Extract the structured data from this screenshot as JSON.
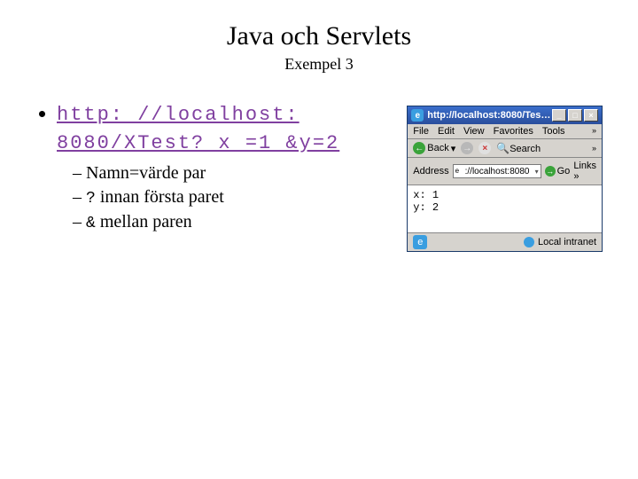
{
  "title": "Java och Servlets",
  "subtitle": "Exempel 3",
  "main_url_display": "http: //localhost: 8080/XTest? x =1 &y=2",
  "sub_bullets": [
    {
      "prefix_mono": "",
      "text": "Namn=värde par"
    },
    {
      "prefix_mono": "?",
      "text": " innan första paret"
    },
    {
      "prefix_mono": "&",
      "text": " mellan paren"
    }
  ],
  "browser": {
    "title": "http://localhost:8080/Tes…",
    "window_controls": {
      "minimize": "_",
      "maximize": "□",
      "close": "×"
    },
    "menu": [
      "File",
      "Edit",
      "View",
      "Favorites",
      "Tools"
    ],
    "menu_overflow": "»",
    "toolbar": {
      "back_label": "Back",
      "back_dropdown": "▾",
      "search_label": "Search",
      "overflow": "»"
    },
    "address": {
      "label": "Address",
      "value": "://localhost:8080",
      "go_label": "Go",
      "links_label": "Links",
      "links_overflow": "»"
    },
    "content_line1": "x: 1",
    "content_line2": "y: 2",
    "status": {
      "zone": "Local intranet"
    }
  }
}
